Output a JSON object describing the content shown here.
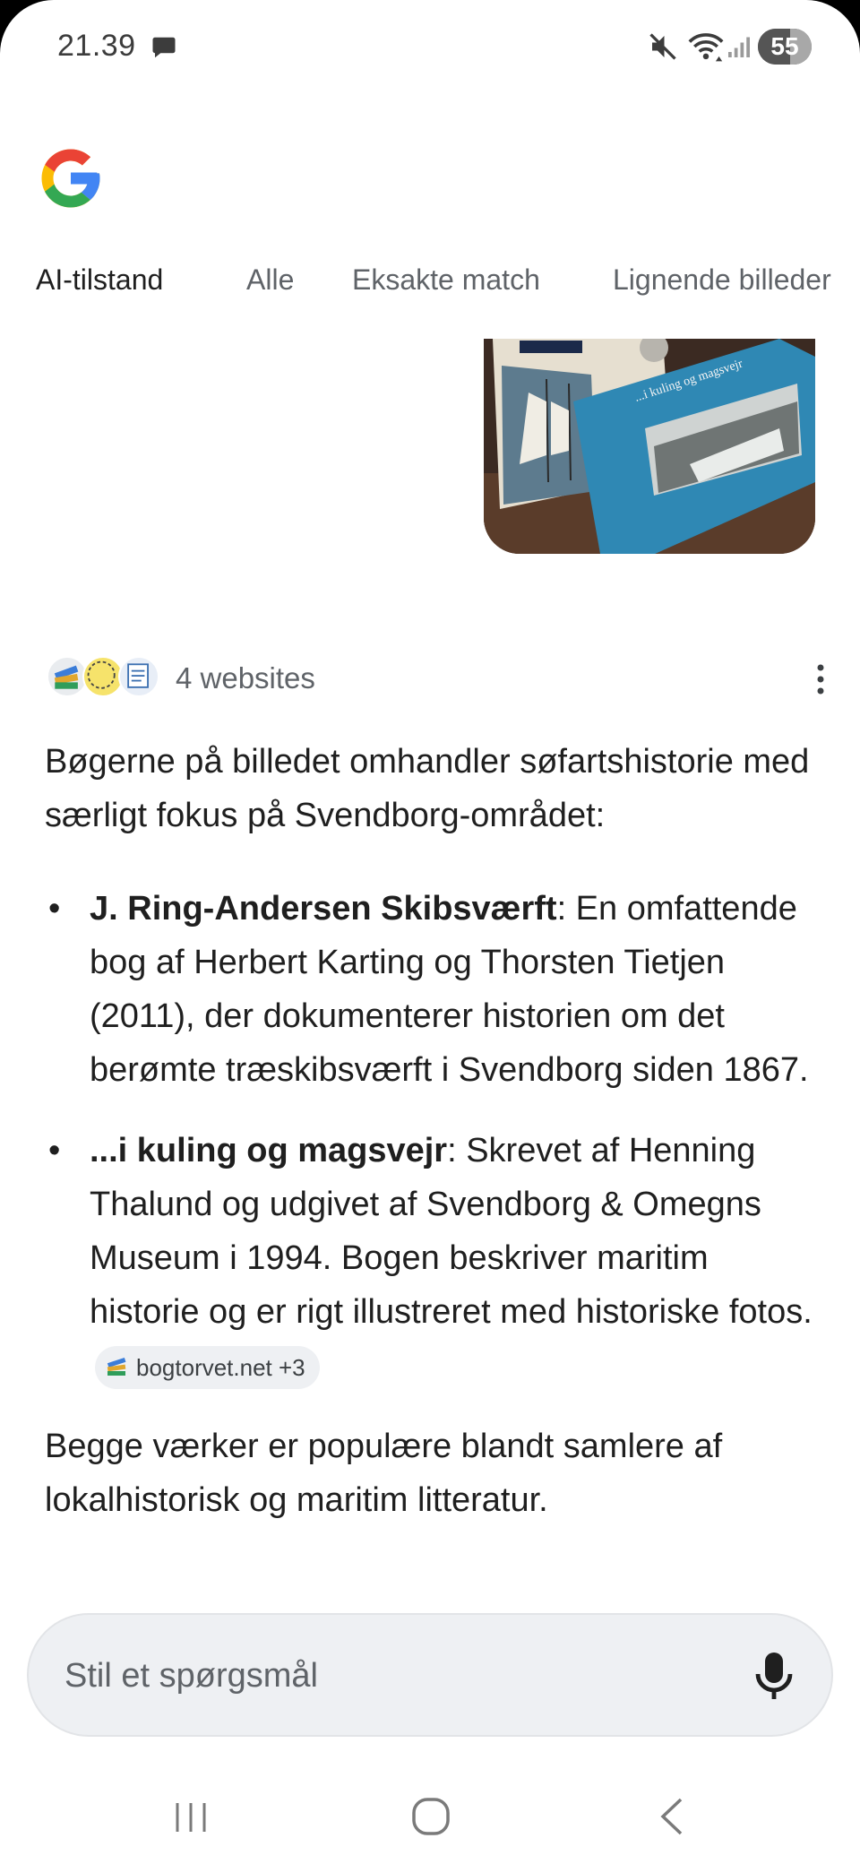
{
  "status_bar": {
    "time": "21.39",
    "battery_level": "55"
  },
  "tabs": [
    {
      "label": "AI-tilstand",
      "active": true
    },
    {
      "label": "Alle",
      "active": false
    },
    {
      "label": "Eksakte match",
      "active": false
    },
    {
      "label": "Lignende billeder",
      "active": false
    }
  ],
  "sources": {
    "label": "4 websites"
  },
  "answer": {
    "intro": "Bøgerne på billedet omhandler søfartshistorie med særligt fokus på Svendborg-området:",
    "items": [
      {
        "title": "J. Ring-Andersen Skibsværft",
        "text": ": En omfattende bog af Herbert Karting og Thorsten Tietjen (2011), der dokumenterer historien om det berømte træskibsværft i Svendborg siden 1867."
      },
      {
        "title": "...i kuling og magsvejr",
        "text": ": Skrevet af Henning Thalund og udgivet af Svendborg & Omegns Museum i 1994. Bogen beskriver maritim historie og er rigt illustreret med historiske fotos.",
        "chip": "bogtorvet.net +3"
      }
    ],
    "closing": "Begge værker er populære blandt samlere af lokalhistorisk og maritim litteratur."
  },
  "ask": {
    "placeholder": "Stil et spørgsmål"
  },
  "colors": {
    "google_blue": "#4285F4",
    "google_red": "#EA4335",
    "google_yellow": "#FBBC05",
    "google_green": "#34A853",
    "text_primary": "#1f1f1f",
    "text_secondary": "#5f6368",
    "input_bg": "#eef0f3"
  },
  "icons": [
    "chat-bubble-icon",
    "mute-icon",
    "wifi-icon",
    "signal-icon",
    "more-vert-icon",
    "mic-icon",
    "nav-recent-icon",
    "nav-home-icon",
    "nav-back-icon"
  ]
}
